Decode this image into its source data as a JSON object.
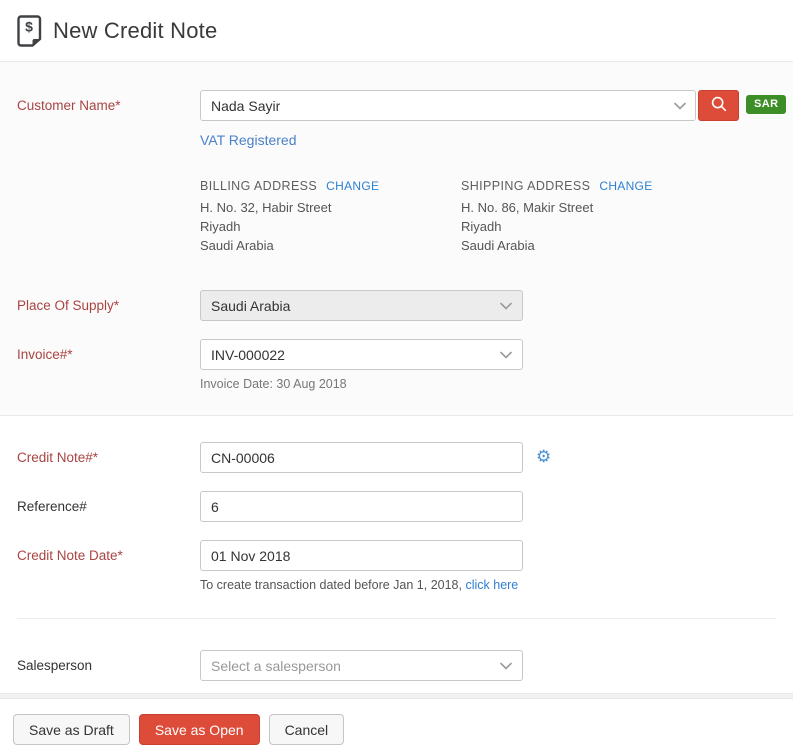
{
  "header": {
    "title": "New Credit Note"
  },
  "customer": {
    "label": "Customer Name*",
    "value": "Nada Sayir",
    "vat_link": "VAT Registered",
    "currency_badge": "SAR"
  },
  "addresses": {
    "billing": {
      "title": "BILLING ADDRESS",
      "change_label": "CHANGE",
      "lines": [
        "H. No. 32, Habir Street",
        "Riyadh",
        "Saudi Arabia"
      ]
    },
    "shipping": {
      "title": "SHIPPING ADDRESS",
      "change_label": "CHANGE",
      "lines": [
        "H. No. 86, Makir Street",
        "Riyadh",
        "Saudi Arabia"
      ]
    }
  },
  "fields": {
    "place_of_supply": {
      "label": "Place Of Supply*",
      "value": "Saudi Arabia"
    },
    "invoice": {
      "label": "Invoice#*",
      "value": "INV-000022",
      "note": "Invoice Date: 30 Aug 2018"
    },
    "credit_note_number": {
      "label": "Credit Note#*",
      "value": "CN-00006"
    },
    "reference": {
      "label": "Reference#",
      "value": "6"
    },
    "credit_note_date": {
      "label": "Credit Note Date*",
      "value": "01 Nov 2018",
      "note_prefix": "To create transaction dated before Jan 1, 2018, ",
      "note_link": "click here"
    },
    "salesperson": {
      "label": "Salesperson",
      "placeholder": "Select a salesperson"
    }
  },
  "footer": {
    "save_draft": "Save as Draft",
    "save_open": "Save as Open",
    "cancel": "Cancel"
  },
  "icons": {
    "header": "credit-note-icon",
    "search": "search-icon",
    "settings": "gear-icon",
    "dropdown": "chevron-down-icon",
    "settings_glyph": "⚙"
  },
  "colors": {
    "accent_red": "#dd4b39",
    "badge_green": "#3d8e27",
    "required_label_red": "#a94442",
    "link_blue": "#2f80d3"
  }
}
